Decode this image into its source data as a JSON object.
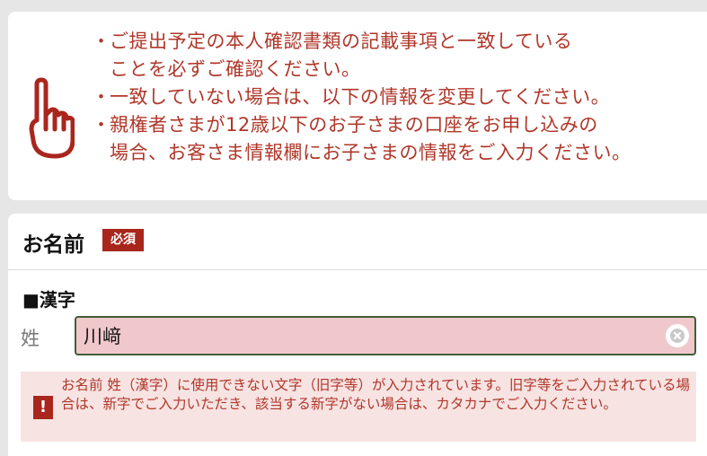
{
  "notice": {
    "items": [
      {
        "bullet": "・",
        "text": "ご提出予定の本人確認書類の記載事項と一致している\nことを必ずご確認ください。"
      },
      {
        "bullet": "・",
        "text": "一致していない場合は、以下の情報を変更してください。"
      },
      {
        "bullet": "・",
        "text": "親権者さまが12歳以下のお子さまの口座をお申し込みの\n場合、お客さま情報欄にお子さまの情報をご入力ください。"
      }
    ],
    "icon": "pointing-hand-icon"
  },
  "form": {
    "section_title": "お名前",
    "required_badge": "必須",
    "sub_heading": "■漢字",
    "last_name": {
      "label": "姓",
      "value": "川﨑"
    },
    "error": {
      "icon_text": "!",
      "message": "お名前 姓（漢字）に使用できない文字（旧字等）が入力されています。旧字等をご入力されている場合は、新字でご入力いただき、該当する新字がない場合は、カタカナでご入力ください。"
    }
  },
  "colors": {
    "accent_red": "#a9261d",
    "notice_text": "#b0372a",
    "input_error_bg": "#f0c8cc",
    "input_border": "#3f5e34",
    "error_box_bg": "#f7e3e2"
  }
}
